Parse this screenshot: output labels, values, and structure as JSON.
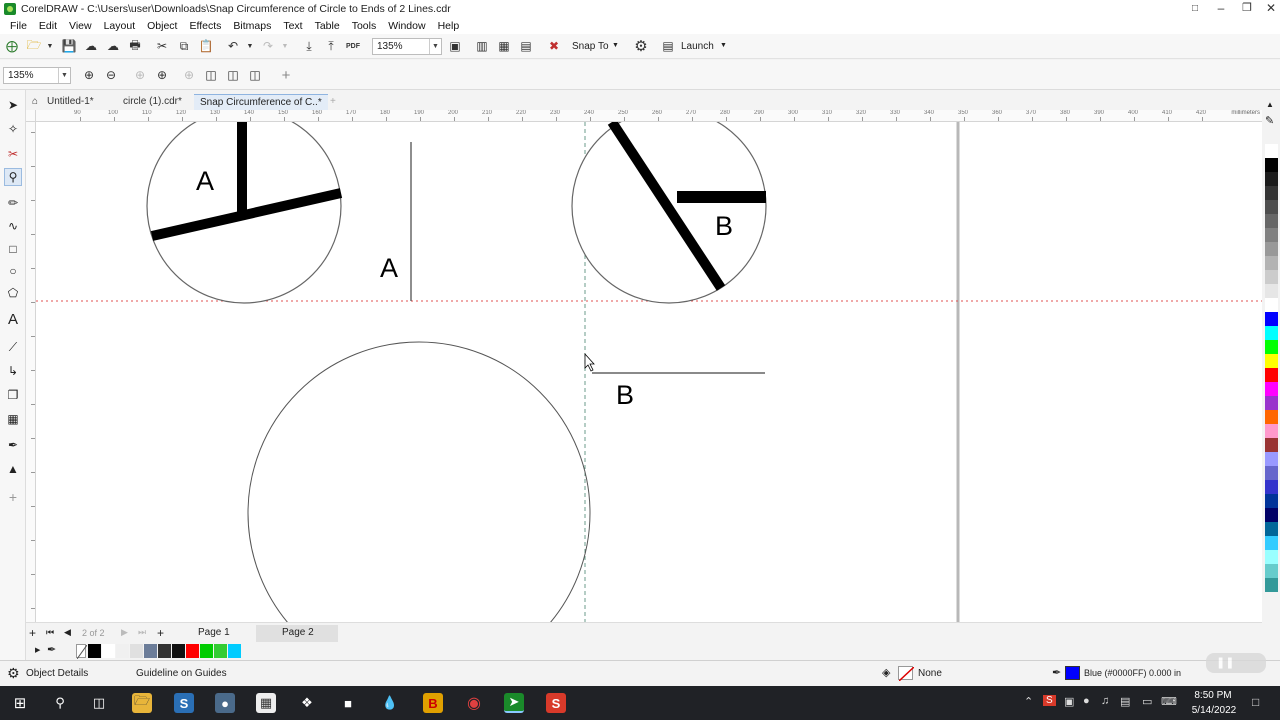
{
  "titlebar": {
    "title": "CorelDRAW - C:\\Users\\user\\Downloads\\Snap Circumference of Circle to Ends of 2 Lines.cdr"
  },
  "menu": [
    "File",
    "Edit",
    "View",
    "Layout",
    "Object",
    "Effects",
    "Bitmaps",
    "Text",
    "Table",
    "Tools",
    "Window",
    "Help"
  ],
  "toolbar": {
    "zoom_value": "135%",
    "snap_to": "Snap To",
    "launch": "Launch",
    "pdf": "PDF"
  },
  "propbar": {
    "zoom_value": "135%"
  },
  "tabs": [
    "Untitled-1*",
    "circle (1).cdr*",
    "Snap Circumference of C..*"
  ],
  "ruler": {
    "unit": "millimeters",
    "ticks": [
      "90",
      "100",
      "110",
      "120",
      "130",
      "140",
      "150",
      "160",
      "170",
      "180",
      "190",
      "200",
      "210",
      "220",
      "230",
      "240",
      "250",
      "260",
      "270",
      "280",
      "290",
      "300",
      "310",
      "320",
      "330",
      "340",
      "350",
      "360",
      "370",
      "380",
      "390",
      "400",
      "410",
      "420"
    ]
  },
  "canvas": {
    "label_a1": "A",
    "label_a2": "A",
    "label_b1": "B",
    "label_b2": "B"
  },
  "pagenav": {
    "page_counter": "2 of 2",
    "page1": "Page 1",
    "page2": "Page 2"
  },
  "status": {
    "object_details": "Object Details",
    "message": "Guideline on Guides",
    "fill": "None",
    "outline": "Blue (#0000FF)  0.000 in"
  },
  "taskbar": {
    "time": "8:50 PM",
    "date": "5/14/2022"
  },
  "palette_colors": [
    "#ffffff",
    "#000000",
    "#1a1a1a",
    "#333333",
    "#4d4d4d",
    "#666666",
    "#808080",
    "#999999",
    "#b3b3b3",
    "#cccccc",
    "#e6e6e6",
    "#ffffff",
    "#0000ff",
    "#00ffff",
    "#00ff00",
    "#ffff00",
    "#ff0000",
    "#ff00ff",
    "#9933cc",
    "#ff6600",
    "#ff99cc",
    "#993333",
    "#9999ff",
    "#6666cc",
    "#3333cc",
    "#003399",
    "#000066",
    "#006699",
    "#33ccff",
    "#99ffff",
    "#66cccc",
    "#339999"
  ],
  "doc_palette": [
    "#000000",
    "#ffffff",
    "#f0f0f0",
    "#e0e0e0",
    "#6c7d99",
    "#333333",
    "#111111",
    "#ff0000",
    "#00cc00",
    "#33cc33",
    "#00ccff"
  ]
}
